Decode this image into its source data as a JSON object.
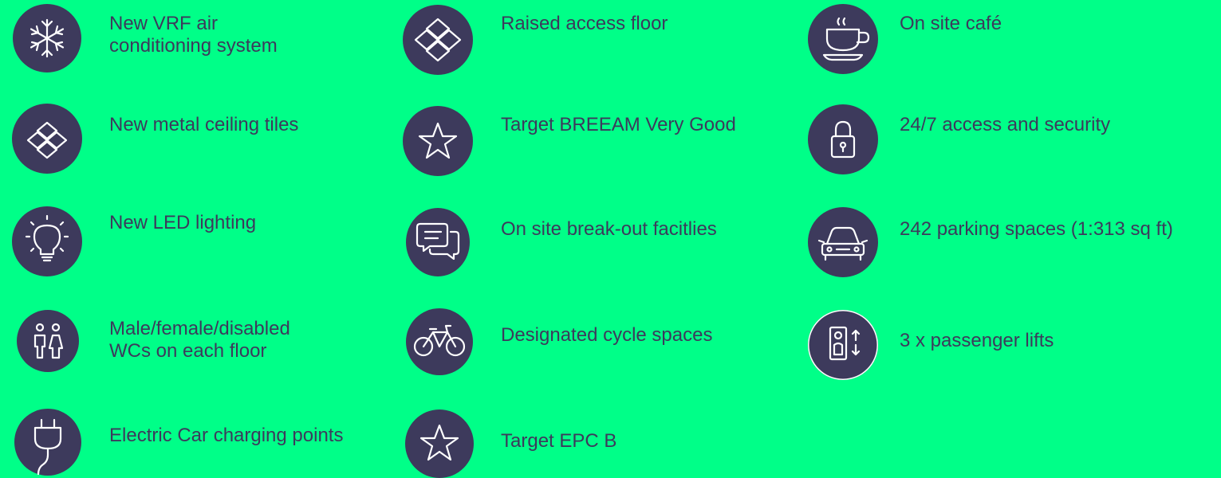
{
  "colors": {
    "background": "#00ff88",
    "circle": "#3d3a5c",
    "text": "#3d3a5c",
    "icon_stroke": "#ffffff"
  },
  "features": [
    {
      "icon": "snowflake-icon",
      "lines": [
        "New VRF air",
        "conditioning system"
      ]
    },
    {
      "icon": "floor-tiles-icon",
      "lines": [
        "Raised access floor"
      ]
    },
    {
      "icon": "coffee-cup-icon",
      "lines": [
        "On site café"
      ]
    },
    {
      "icon": "ceiling-tiles-icon",
      "lines": [
        "New metal ceiling tiles"
      ]
    },
    {
      "icon": "star-icon",
      "lines": [
        "Target BREEAM Very Good"
      ]
    },
    {
      "icon": "padlock-icon",
      "lines": [
        "24/7 access and security"
      ]
    },
    {
      "icon": "light-bulb-icon",
      "lines": [
        "New LED lighting"
      ]
    },
    {
      "icon": "speech-bubbles-icon",
      "lines": [
        "On site break-out facitlies"
      ]
    },
    {
      "icon": "car-icon",
      "lines": [
        "242 parking spaces (1:313 sq ft)"
      ]
    },
    {
      "icon": "toilets-icon",
      "lines": [
        "Male/female/disabled",
        "WCs on each floor"
      ]
    },
    {
      "icon": "bicycle-icon",
      "lines": [
        "Designated cycle spaces"
      ]
    },
    {
      "icon": "lift-icon",
      "lines": [
        "3 x passenger lifts"
      ]
    },
    {
      "icon": "electric-plug-icon",
      "lines": [
        "Electric Car charging points"
      ]
    },
    {
      "icon": "star-icon",
      "lines": [
        "Target EPC B"
      ]
    }
  ]
}
